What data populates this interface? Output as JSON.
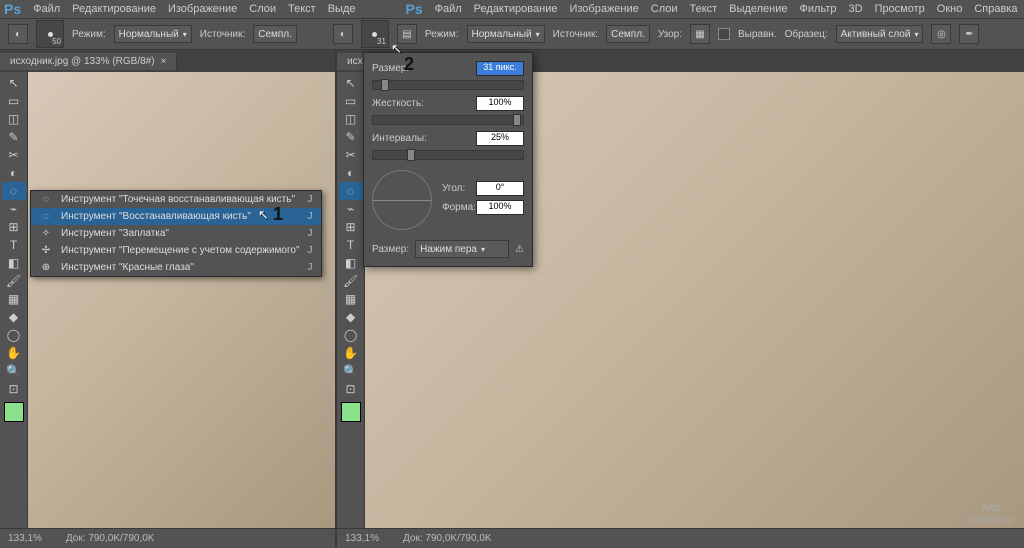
{
  "app": {
    "logo": "Ps"
  },
  "menu": {
    "left": [
      "Файл",
      "Редактирование",
      "Изображение",
      "Слои",
      "Текст",
      "Выде"
    ],
    "right": [
      "Файл",
      "Редактирование",
      "Изображение",
      "Слои",
      "Текст",
      "Выделение",
      "Фильтр",
      "3D",
      "Просмотр",
      "Окно",
      "Справка"
    ]
  },
  "options1": {
    "brush_size": "50",
    "mode_label": "Режим:",
    "mode_value": "Нормальный",
    "source_label": "Источник:",
    "source_value": "Семпл."
  },
  "options2": {
    "brush_size": "31",
    "mode_label": "Режим:",
    "mode_value": "Нормальный",
    "source_label": "Источник:",
    "source_value": "Семпл.",
    "pattern_label": "Узор:",
    "aligned_label": "Выравн.",
    "sample_label": "Образец:",
    "sample_value": "Активный слой"
  },
  "tab": {
    "title": "исходник.jpg @ 133% (RGB/8#)"
  },
  "statusbar": {
    "zoom": "133,1%",
    "doc_label": "Док:",
    "doc_value": "790,0K/790,0K"
  },
  "flyout": {
    "items": [
      {
        "icon": "◌",
        "label": "Инструмент \"Точечная восстанавливающая кисть\"",
        "key": "J"
      },
      {
        "icon": "◌",
        "label": "Инструмент \"Восстанавливающая кисть\"",
        "key": "J",
        "sel": true
      },
      {
        "icon": "✧",
        "label": "Инструмент \"Заплатка\"",
        "key": "J"
      },
      {
        "icon": "✢",
        "label": "Инструмент \"Перемещение с учетом содержимого\"",
        "key": "J"
      },
      {
        "icon": "⊕",
        "label": "Инструмент \"Красные глаза\"",
        "key": "J"
      }
    ]
  },
  "brush_panel": {
    "size_label": "Размер:",
    "size_value": "31 пикс.",
    "hardness_label": "Жесткость:",
    "hardness_value": "100%",
    "spacing_label": "Интервалы:",
    "spacing_value": "25%",
    "angle_label": "Угол:",
    "angle_value": "0°",
    "form_label": "Форма:",
    "form_value": "100%",
    "footer_label": "Размер:",
    "footer_select": "Нажим пера"
  },
  "tools": [
    "↖",
    "▭",
    "◫",
    "✎",
    "✂",
    "◐",
    "◌",
    "⌁",
    "⊞",
    "T",
    "◧",
    "🖌",
    "▦",
    "◆",
    "◯",
    "✋",
    "🔍",
    "⊡"
  ],
  "annotations": {
    "one": "1",
    "two": "2"
  },
  "watermark": {
    "line1": "Arts",
    "line2": "komok.ru"
  }
}
